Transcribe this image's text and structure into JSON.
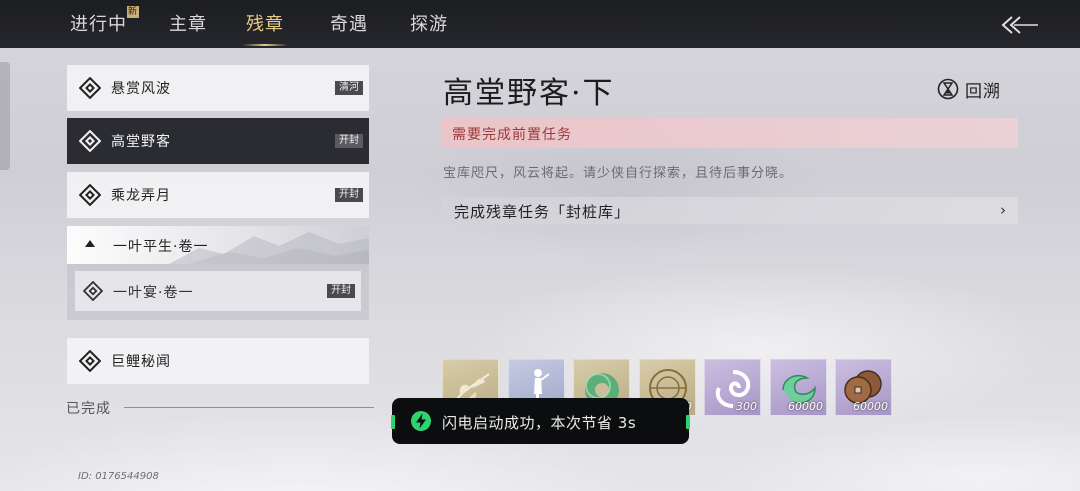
{
  "top_tabs": [
    {
      "label": "进行中",
      "badge": "新"
    },
    {
      "label": "主章"
    },
    {
      "label": "残章",
      "active": true
    },
    {
      "label": "奇遇"
    },
    {
      "label": "探游"
    }
  ],
  "icons": {
    "back": "double-chevron-left-arrow-icon",
    "list_item": "diamond-emblem-icon",
    "recall": "hourglass-icon",
    "task_chevron": "chevron-right-icon",
    "toast": "lightning-bolt-icon"
  },
  "quest_list": [
    {
      "label": "悬赏风波",
      "tag": "清河"
    },
    {
      "label": "高堂野客",
      "tag": "开封",
      "selected": true
    },
    {
      "label": "乘龙弄月",
      "tag": "开封"
    }
  ],
  "quest_group": {
    "label": "一叶平生·卷一",
    "items": [
      {
        "label": "一叶宴·卷一",
        "tag": "开封"
      }
    ]
  },
  "quest_after": {
    "label": "巨鲤秘闻"
  },
  "completed_section": "已完成",
  "user_id": "ID: 0176544908",
  "detail": {
    "title": "高堂野客·下",
    "recall_label": "回溯",
    "requirement": "需要完成前置任务",
    "description": "宝库咫尺，风云将起。请少侠自行探索，且待后事分晓。",
    "task": "完成残章任务「封桩库」",
    "task_chevron": "›"
  },
  "rewards": [
    {
      "item": "wild-herb",
      "quantity": "",
      "rarity": "gold"
    },
    {
      "item": "figure",
      "quantity": "",
      "rarity": "blue"
    },
    {
      "item": "jade-pendant",
      "quantity": "",
      "rarity": "gold"
    },
    {
      "item": "compass-token",
      "quantity": "0",
      "rarity": "gold"
    },
    {
      "item": "swirl-essence",
      "quantity": "300",
      "rarity": "purple"
    },
    {
      "item": "wind-essence",
      "quantity": "60000",
      "rarity": "purple"
    },
    {
      "item": "copper-coins",
      "quantity": "60000",
      "rarity": "purple"
    }
  ],
  "toast": {
    "message": "闪电启动成功，本次节省 3s"
  },
  "colors": {
    "active_tab": "#e8c98a",
    "topbar": "#1c1d21",
    "requirement_bg": "#ecc4c8",
    "requirement_text": "#9a3a3a",
    "toast_accent": "#2dd36f"
  }
}
